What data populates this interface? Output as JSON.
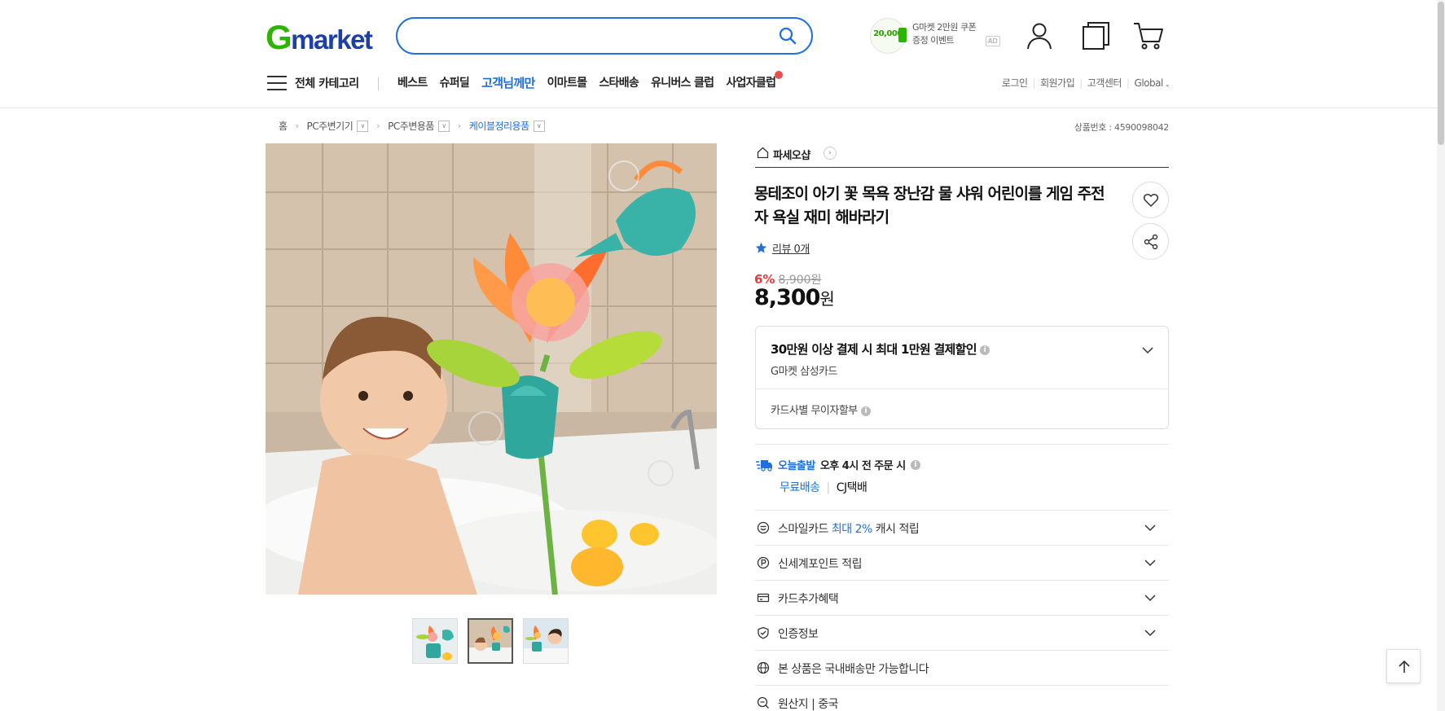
{
  "header": {
    "logo_g": "G",
    "logo_rest": "market",
    "search_placeholder": "",
    "coupon_amount": "20,000",
    "coupon_line1": "G마켓 2만원 쿠폰",
    "coupon_line2": "증정 이벤트",
    "coupon_ad": "AD",
    "icons": [
      "search-icon",
      "user-icon",
      "recent-items-icon",
      "cart-icon"
    ]
  },
  "gnb": {
    "all_categories": "전체 카테고리",
    "menu": [
      "베스트",
      "슈퍼딜",
      "고객님께만",
      "이마트몰",
      "스타배송",
      "유니버스 클럽",
      "사업자클럽"
    ],
    "highlight_index": 2,
    "util": [
      "로그인",
      "회원가입",
      "고객센터",
      "Global"
    ]
  },
  "breadcrumb": {
    "home": "홈",
    "items": [
      "PC주변기기",
      "PC주변용품",
      "케이블정리용품"
    ],
    "product_no": "상품번호 : 4590098042"
  },
  "product": {
    "shop_name": "파세오샵",
    "title": "몽테조이 아기 꽃 목욕 장난감 물 샤워 어린이를 게임 주전자 욕실 재미 해바라기",
    "review": "리뷰 0개",
    "discount_pct": "6%",
    "original_price": "8,900원",
    "price": "8,300",
    "price_unit": "원",
    "card_offer_title": "30만원 이상 결제 시 최대 1만원 결제할인",
    "card_offer_card": "G마켓 삼성카드",
    "installment": "카드사별 무이자할부",
    "shipping": {
      "today_label": "오늘출발",
      "deadline": "오후 4시 전 주문 시",
      "free": "무료배송",
      "courier": "CJ택배"
    },
    "benefits": [
      {
        "icon": "smilecard-icon",
        "pre": "스마일카드 ",
        "blue": "최대 2%",
        "post": " 캐시 적립",
        "expandable": true
      },
      {
        "icon": "point-icon",
        "pre": "신세계포인트 적립",
        "blue": "",
        "post": "",
        "expandable": true
      },
      {
        "icon": "card-icon",
        "pre": "카드추가혜택",
        "blue": "",
        "post": "",
        "expandable": true
      },
      {
        "icon": "certification-icon",
        "pre": "인증정보",
        "blue": "",
        "post": "",
        "expandable": true
      },
      {
        "icon": "globe-icon",
        "pre": "본 상품은 국내배송만 가능합니다",
        "blue": "",
        "post": "",
        "expandable": false
      },
      {
        "icon": "origin-icon",
        "pre": "원산지",
        "blue": "",
        "post": " | 중국",
        "expandable": false
      }
    ]
  },
  "colors": {
    "accent_blue": "#1f6fdc",
    "logo_green": "#2db400",
    "discount_red": "#e93a3a"
  }
}
